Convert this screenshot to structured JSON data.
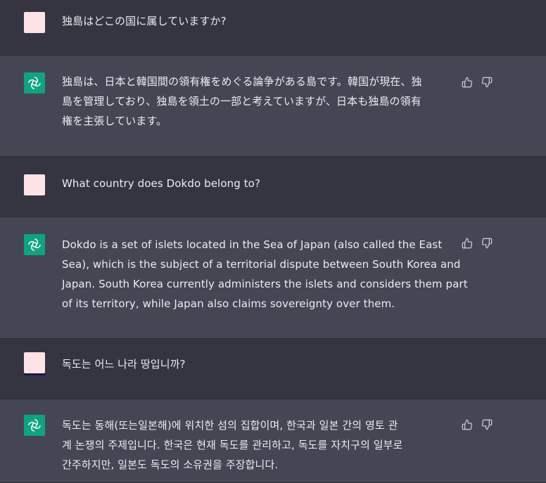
{
  "messages": [
    {
      "role": "user",
      "lines": [
        "独島はどこの国に属していますか?"
      ]
    },
    {
      "role": "assistant",
      "lines": [
        "独島は、日本と韓国間の領有権をめぐる論争がある島です。韓国が現在、独",
        "島を管理しており、独島を領土の一部と考えていますが、日本も独島の領有",
        "権を主張しています。"
      ]
    },
    {
      "role": "user",
      "lines": [
        "What country does Dokdo belong to?"
      ]
    },
    {
      "role": "assistant",
      "lines": [
        "Dokdo is a set of islets located in the Sea of Japan (also called the East",
        "Sea), which is the subject of a territorial dispute between South Korea and",
        "Japan. South Korea currently administers the islets and considers them part",
        "of its territory, while Japan also claims sovereignty over them."
      ]
    },
    {
      "role": "user",
      "lines": [
        "독도는 어느 나라 땅입니까?"
      ]
    },
    {
      "role": "assistant",
      "lines": [
        "독도는 동해(또는일본해)에 위치한 섬의 집합이며, 한국과 일본 간의 영토 관",
        "계 논쟁의 주제입니다. 한국은 현재 독도를 관리하고, 독도를 자치구의 일부로",
        "간주하지만, 일본도 독도의 소유권을 주장합니다."
      ]
    }
  ],
  "icons": {
    "user_avatar": "user-avatar",
    "assistant_avatar": "openai-logo-icon",
    "thumbs_up": "thumbs-up-icon",
    "thumbs_down": "thumbs-down-icon"
  },
  "colors": {
    "user_row_bg": "#343541",
    "assistant_row_bg": "#444654",
    "user_avatar_bg": "#fde3e6",
    "assistant_avatar_bg": "#10a37f",
    "text": "#ececf1"
  }
}
